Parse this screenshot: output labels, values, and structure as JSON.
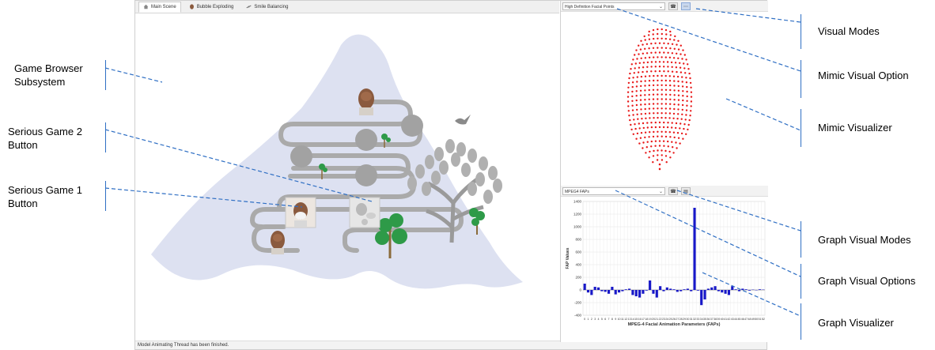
{
  "tabs": [
    {
      "label": "Main Scene",
      "icon": "house-icon",
      "active": true
    },
    {
      "label": "Bubble Exploding",
      "icon": "face-icon",
      "active": false
    },
    {
      "label": "Smile Balancing",
      "icon": "scale-icon",
      "active": false
    }
  ],
  "status_text": "Model Animating Thread has been finished.",
  "mimic": {
    "mode_select": "High Definition Facial Points"
  },
  "graph": {
    "mode_select": "MPEG4 FAPs"
  },
  "annotations": {
    "game_browser_l1": "Game Browser",
    "game_browser_l2": "Subsystem",
    "sg2_l1": "Serious Game 2",
    "sg2_l2": "Button",
    "sg1_l1": "Serious Game 1",
    "sg1_l2": "Button",
    "visual_modes": "Visual Modes",
    "mimic_option": "Mimic Visual Option",
    "mimic_visualizer": "Mimic Visualizer",
    "graph_modes": "Graph Visual Modes",
    "graph_options": "Graph Visual Options",
    "graph_visualizer": "Graph Visualizer"
  },
  "colors": {
    "accent": "#2f6fc4",
    "mountain": "#dde1f1",
    "path": "#a8a8a8",
    "node": "#a2a2a2",
    "tree": "#2e9a48",
    "bar": "#1818c8",
    "face_points": "#e81818"
  },
  "chart_data": {
    "type": "bar",
    "xlabel": "MPEG-4 Facial Animation Parameters (FAPs)",
    "ylabel": "FAP Values",
    "ylim": [
      -400,
      1400
    ],
    "yticks": [
      -400,
      -200,
      0,
      200,
      400,
      600,
      800,
      1000,
      1200,
      1400
    ],
    "x_tick_labels": [
      "0",
      "1",
      "2",
      "3",
      "4",
      "5",
      "6",
      "7",
      "8",
      "9",
      "10",
      "11",
      "12",
      "13",
      "14",
      "15",
      "16",
      "17",
      "18",
      "19",
      "20",
      "21",
      "22",
      "23",
      "24",
      "25",
      "26",
      "27",
      "28",
      "29",
      "30",
      "31",
      "32",
      "33",
      "34",
      "35",
      "36",
      "37",
      "38",
      "39",
      "40",
      "41",
      "42",
      "43",
      "44",
      "45",
      "46",
      "47",
      "48",
      "49",
      "50",
      "51",
      "52"
    ],
    "values": [
      100,
      -40,
      -80,
      50,
      40,
      -20,
      -30,
      -60,
      50,
      -70,
      -40,
      -20,
      10,
      20,
      -80,
      -100,
      -120,
      -60,
      -10,
      150,
      -60,
      -120,
      60,
      -20,
      40,
      20,
      10,
      -30,
      -20,
      10,
      20,
      -20,
      1300,
      -10,
      -240,
      -150,
      20,
      40,
      60,
      -20,
      -40,
      -60,
      -80,
      60,
      10,
      -20,
      20,
      10,
      -10,
      5,
      -5,
      10,
      5
    ],
    "grid": true
  }
}
